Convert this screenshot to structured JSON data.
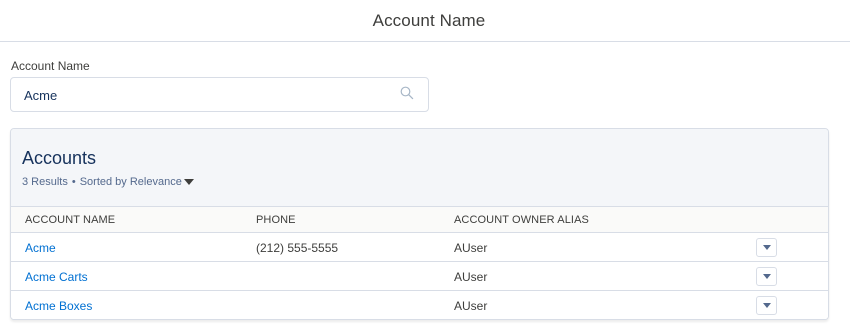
{
  "modal": {
    "title": "Account Name"
  },
  "search": {
    "label": "Account Name",
    "value": "Acme",
    "icon": "search-icon"
  },
  "results_card": {
    "title": "Accounts",
    "count_text": "3 Results",
    "separator": "•",
    "sort_text": "Sorted by Relevance",
    "columns": [
      "ACCOUNT NAME",
      "PHONE",
      "ACCOUNT OWNER ALIAS"
    ],
    "rows": [
      {
        "name": "Acme",
        "phone": "(212) 555-5555",
        "owner": "AUser"
      },
      {
        "name": "Acme Carts",
        "phone": "",
        "owner": "AUser"
      },
      {
        "name": "Acme Boxes",
        "phone": "",
        "owner": "AUser"
      }
    ]
  },
  "colors": {
    "link": "#0070d2",
    "title": "#16325c",
    "border": "#d8dde6"
  }
}
